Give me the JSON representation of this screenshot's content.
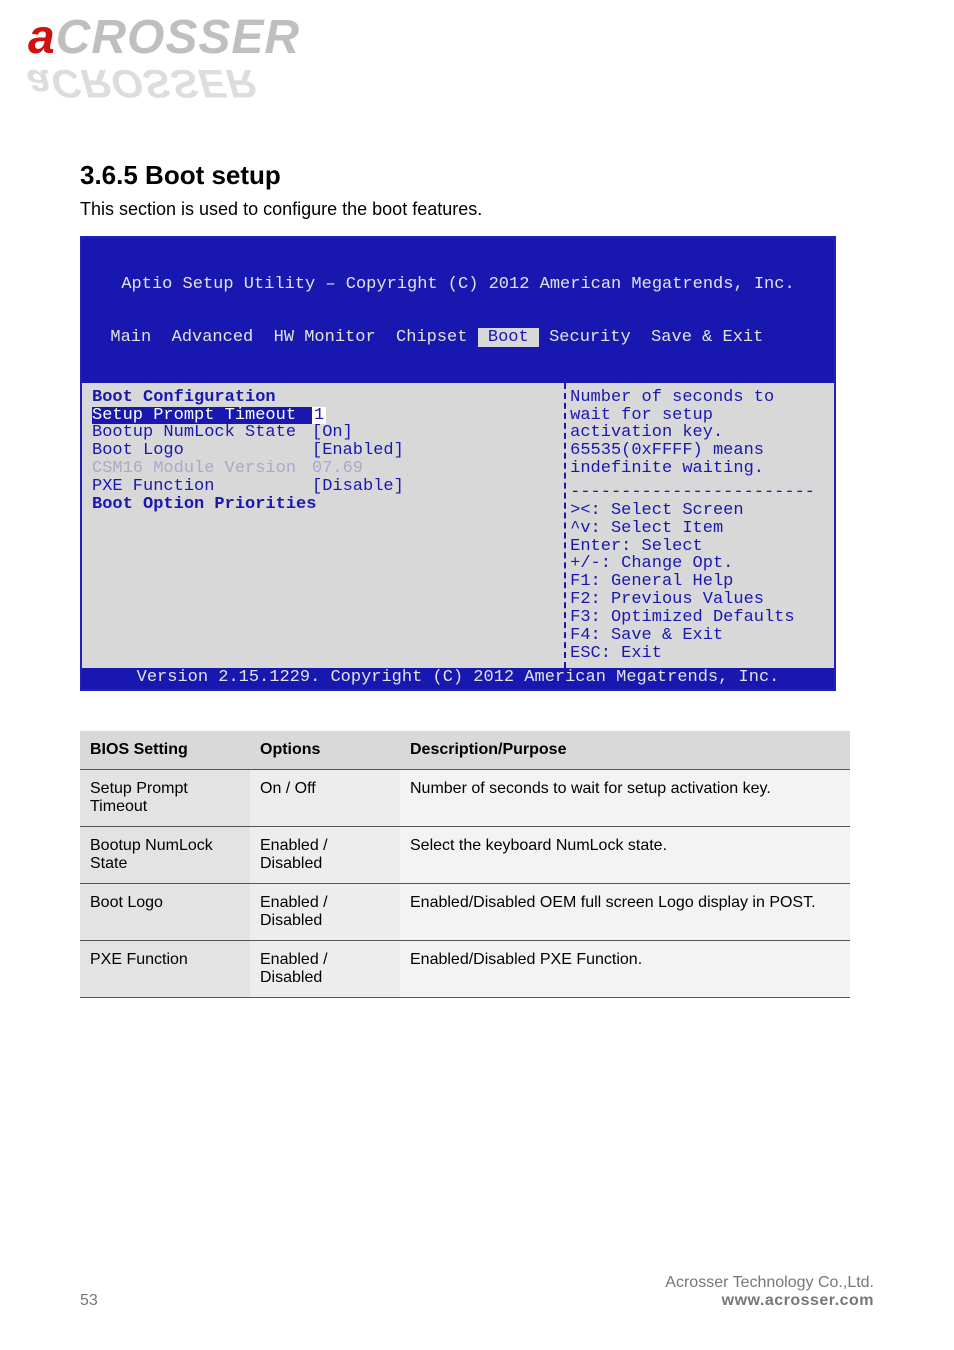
{
  "logo": {
    "a": "a",
    "rest": "CROSSER",
    "shadow": "aCROSSER"
  },
  "section_heading": "3.6.5 Boot setup",
  "section_body": "This section is used to configure the boot features.",
  "bios": {
    "title": "Aptio Setup Utility – Copyright (C) 2012 American Megatrends, Inc.",
    "tabs": {
      "pre": "  Main  Advanced  HW Monitor  Chipset ",
      "active": " Boot ",
      "post": " Security  Save & Exit",
      "active_name": "Boot"
    },
    "left": {
      "header": "Boot Configuration",
      "rows": [
        {
          "label": "Setup Prompt Timeout",
          "value": "1",
          "sel": true
        },
        {
          "label": "Bootup NumLock State",
          "value": "[On]"
        },
        {
          "label": "",
          "value": ""
        },
        {
          "label": "Boot Logo",
          "value": "[Enabled]"
        },
        {
          "label": "",
          "value": ""
        },
        {
          "label": "CSM16 Module Version",
          "value": "07.69",
          "dim": true
        },
        {
          "label": "",
          "value": ""
        },
        {
          "label": "PXE Function",
          "value": "[Disable]"
        },
        {
          "label": "",
          "value": ""
        },
        {
          "label": "",
          "value": ""
        },
        {
          "label": "Boot Option Priorities",
          "value": "",
          "hdr2": true
        }
      ]
    },
    "right": {
      "help_lines": [
        "Number of seconds to",
        "wait for setup",
        "activation key.",
        "65535(0xFFFF) means",
        "indefinite waiting."
      ],
      "divider": "------------------------",
      "keys": [
        "><: Select Screen",
        "^v: Select Item",
        "Enter: Select",
        "+/-: Change Opt.",
        "F1: General Help",
        "F2: Previous Values",
        "F3: Optimized Defaults",
        "F4: Save & Exit",
        "ESC: Exit"
      ]
    },
    "footer": "Version 2.15.1229. Copyright (C) 2012 American Megatrends, Inc."
  },
  "table": {
    "headers": [
      "BIOS Setting",
      "Options",
      "Description/Purpose"
    ],
    "rows": [
      [
        "Setup Prompt Timeout",
        "On / Off",
        "Number of seconds to wait for setup activation key."
      ],
      [
        "Bootup NumLock State",
        "Enabled / Disabled",
        "Select the keyboard NumLock state."
      ],
      [
        "Boot Logo",
        "Enabled / Disabled",
        "Enabled/Disabled OEM full screen Logo display in POST."
      ],
      [
        "PXE Function",
        "Enabled / Disabled",
        "Enabled/Disabled PXE Function."
      ]
    ]
  },
  "footer": {
    "line1": "Acrosser Technology Co.,Ltd.",
    "line2": "www.acrosser.com"
  },
  "pagecount": "53"
}
